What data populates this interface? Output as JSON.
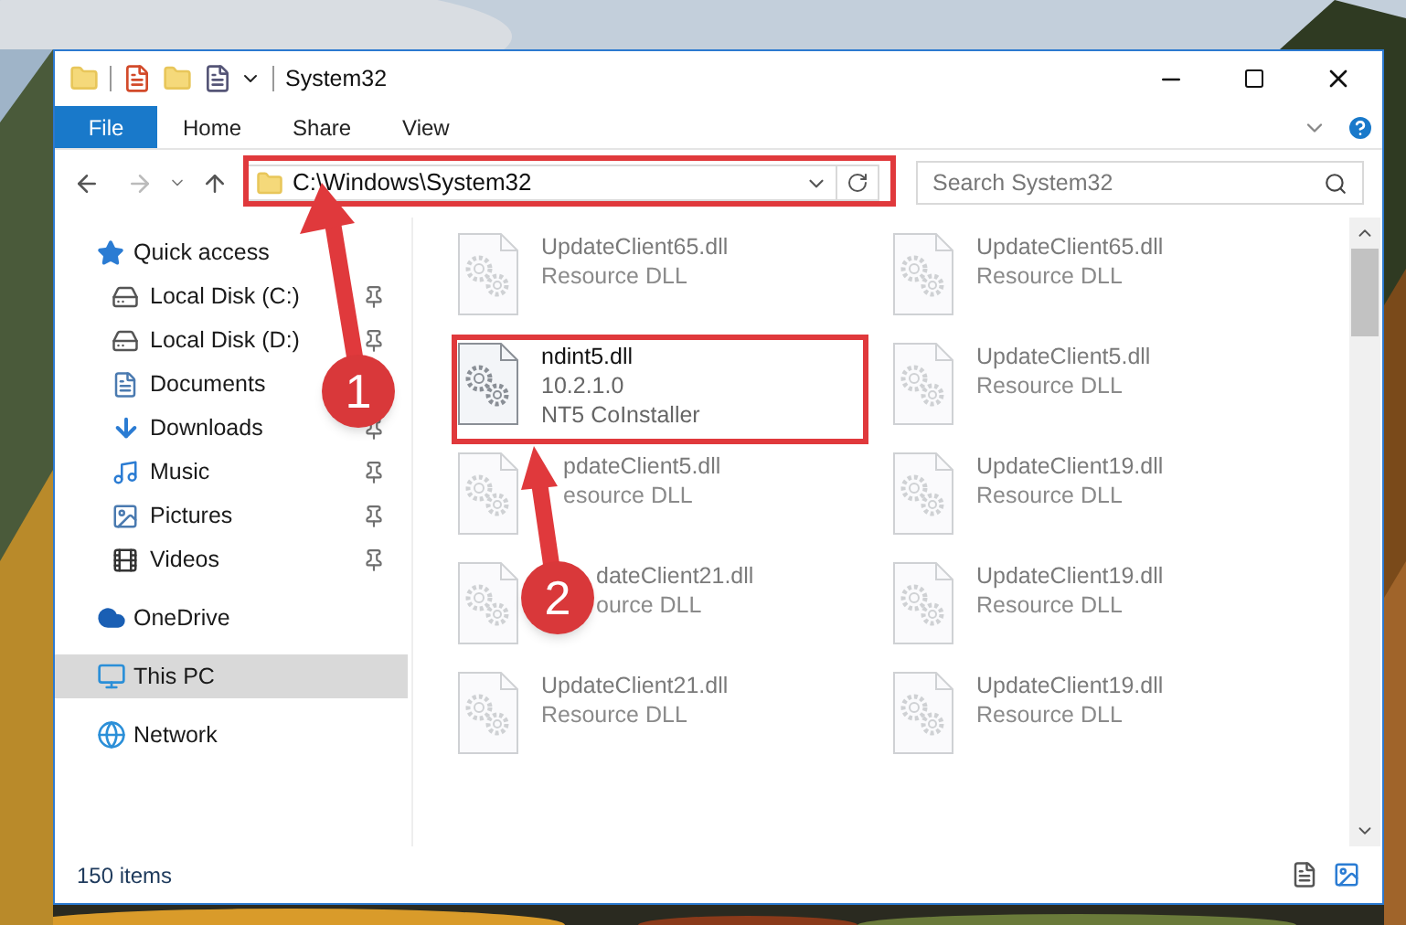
{
  "window": {
    "title": "System32"
  },
  "ribbon_tabs": [
    {
      "label": "File",
      "kind": "file"
    },
    {
      "label": "Home",
      "kind": "tab"
    },
    {
      "label": "Share",
      "kind": "tab"
    },
    {
      "label": "View",
      "kind": "tab"
    }
  ],
  "address_bar": {
    "path": "C:\\Windows\\System32"
  },
  "search": {
    "placeholder": "Search System32"
  },
  "navigation": [
    {
      "label": "Quick access",
      "selected": false,
      "children": [
        {
          "label": "Local Disk (C:)",
          "selected": false,
          "pinned": true
        },
        {
          "label": "Local Disk (D:)",
          "selected": false,
          "pinned": true
        },
        {
          "label": "Documents",
          "selected": false
        },
        {
          "label": "Downloads",
          "selected": false,
          "pinned": true
        },
        {
          "label": "Music",
          "selected": false,
          "pinned": true
        },
        {
          "label": "Pictures",
          "selected": false,
          "pinned": true
        },
        {
          "label": "Videos",
          "selected": false,
          "pinned": true
        }
      ]
    },
    {
      "label": "OneDrive",
      "selected": false
    },
    {
      "label": "This PC",
      "selected": true
    },
    {
      "label": "Network",
      "selected": false
    }
  ],
  "files": [
    {
      "name": "UpdateClient65.dll",
      "details": [
        "Resource DLL"
      ],
      "blurred": true
    },
    {
      "name": "UpdateClient65.dll",
      "details": [
        "Resource DLL"
      ],
      "blurred": true
    },
    {
      "name": "ndint5.dll",
      "details": [
        "10.2.1.0",
        "NT5 CoInstaller"
      ],
      "blurred": false
    },
    {
      "name": "UpdateClient5.dll",
      "details": [
        "Resource DLL"
      ],
      "blurred": true
    },
    {
      "name": "pdateClient5.dll",
      "details": [
        "esource DLL"
      ],
      "blurred": true
    },
    {
      "name": "UpdateClient19.dll",
      "details": [
        "Resource DLL"
      ],
      "blurred": true
    },
    {
      "name": "dateClient21.dll",
      "details": [
        "ource DLL"
      ],
      "blurred": true
    },
    {
      "name": "UpdateClient19.dll",
      "details": [
        "Resource DLL"
      ],
      "blurred": true
    },
    {
      "name": "UpdateClient21.dll",
      "details": [
        "Resource DLL"
      ],
      "blurred": true
    },
    {
      "name": "UpdateClient19.dll",
      "details": [
        "Resource DLL"
      ],
      "blurred": true
    }
  ],
  "status_bar": {
    "item_count": "150 items"
  },
  "annotations": {
    "steps": [
      "1",
      "2"
    ]
  }
}
